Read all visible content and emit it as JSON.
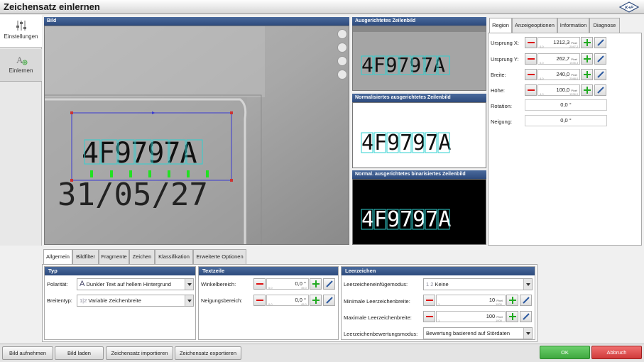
{
  "window": {
    "title": "Zeichensatz einlernen",
    "logo_text": "K+P"
  },
  "sidebar": {
    "items": [
      {
        "label": "Einstellungen",
        "icon": "sliders-icon"
      },
      {
        "label": "Einlernen",
        "icon": "teach-icon"
      }
    ]
  },
  "image_panels": {
    "main": "Bild",
    "aligned": "Ausgerichtetes Zeilenbild",
    "normalized": "Normalisiertes ausgerichtetes Zeilenbild",
    "binarized": "Normal. ausgerichtetes binarisiertes Zeilenbild",
    "ocr_text": "4F9797A",
    "date_text": "31/05/27"
  },
  "right_tabs": [
    "Region",
    "Anzeigeoptionen",
    "Information",
    "Diagnose"
  ],
  "region": {
    "rows": [
      {
        "label": "Ursprung X:",
        "value": "1212,3",
        "unit": "Pixel",
        "min": "0,0",
        "max": "2047,2"
      },
      {
        "label": "Ursprung Y:",
        "value": "262,7",
        "unit": "Pixel",
        "min": "0,0",
        "max": "1535,3"
      },
      {
        "label": "Breite:",
        "value": "240,0",
        "unit": "Pixel",
        "min": "4,0",
        "max": "2048,0"
      },
      {
        "label": "Höhe:",
        "value": "100,0",
        "unit": "Pixel",
        "min": "4,0",
        "max": "1536,0"
      }
    ],
    "rotation_label": "Rotation:",
    "rotation_value": "0,0 °",
    "tilt_label": "Neigung:",
    "tilt_value": "0,0 °"
  },
  "bottom_tabs": [
    "Allgemein",
    "Bildfilter",
    "Fragmente",
    "Zeichen",
    "Klassifikation",
    "Erweiterte Optionen"
  ],
  "typ": {
    "title": "Typ",
    "polarity_label": "Polarität:",
    "polarity_value": "Dunkler Text auf hellem Hintergrund",
    "polarity_icon_text": "A",
    "width_label": "Breitentyp:",
    "width_value": "Variable Zeichenbreite",
    "width_icon_text": "1|2"
  },
  "textzeile": {
    "title": "Textzeile",
    "angle_label": "Winkelbereich:",
    "angle_value": "0,0 °",
    "angle_min": "0,0",
    "angle_max": "45,0",
    "tilt_label": "Neigungsbereich:",
    "tilt_value": "0,0 °",
    "tilt_min": "0,0",
    "tilt_max": "45,0"
  },
  "leerzeichen": {
    "title": "Leerzeichen",
    "mode_label": "Leerzeicheneinfügemodus:",
    "mode_value": "Keine",
    "mode_icon_text": "1 2",
    "min_label": "Minimale Leerzeichenbreite:",
    "min_value": "10",
    "min_unit": "Pixel",
    "min_min": "1",
    "min_max": "1000",
    "max_label": "Maximale Leerzeichenbreite:",
    "max_value": "100",
    "max_unit": "Pixel",
    "max_min": "1",
    "max_max": "1000",
    "eval_label": "Leerzeichenbewertungsmodus:",
    "eval_value": "Bewertung basierend auf Stördaten"
  },
  "footer": {
    "capture": "Bild aufnehmen",
    "load": "Bild laden",
    "import": "Zeichensatz importieren",
    "export": "Zeichensatz exportieren",
    "ok": "OK",
    "cancel": "Abbruch"
  },
  "colors": {
    "header_blue": "#2d4a7c",
    "ok_green": "#3fa83f",
    "cancel_red": "#d03a3a",
    "roi_blue": "#3a3ad0",
    "box_cyan": "#2fd0d0",
    "marker_green": "#22e022"
  }
}
